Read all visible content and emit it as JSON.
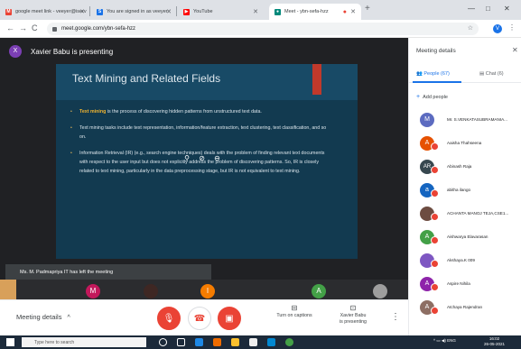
{
  "browser": {
    "tabs": [
      {
        "title": "google meet link - veeyer@iserv",
        "favicon": "gmail-icon",
        "color": "#ea4335",
        "fav_glyph": "M"
      },
      {
        "title": "You are signed in as veeyer.",
        "favicon": "ms-icon",
        "color": "#1a73e8",
        "fav_glyph": "S"
      },
      {
        "title": "YouTube",
        "favicon": "youtube-icon",
        "color": "#ff0000",
        "fav_glyph": "▶"
      },
      {
        "title": "Meet - ybn-sefa-hzz",
        "favicon": "meet-icon",
        "color": "#00897b",
        "fav_glyph": "●"
      }
    ],
    "url": "meet.google.com/ybn-sefa-hzz",
    "profile_initial": "V"
  },
  "meet": {
    "presenter_initial": "X",
    "presenter_text": "Xavier Babu is presenting",
    "slide": {
      "title": "Text Mining and Related Fields",
      "bullet1_highlight": "Text mining",
      "bullet1_rest": " is the process of discovering hidden patterns from unstructured text data.",
      "bullet2": "Text mining tasks include text representation, information/feature extraction, text clustering, text classification, and so on.",
      "bullet3": "Information Retrieval (IR) (e.g., search engine techniques) deals with the problem of finding relevant text documents with respect to the user input but does not explicitly address the problem of discovering patterns. So, IR is closely related to text mining, particularly in the data preprocessing stage, but IR is not equivalent to text mining."
    },
    "toast": "Ms. M. Padmapriya IT has left the meeting",
    "filmstrip": [
      {
        "initial": "M",
        "color": "#c2185b"
      },
      {
        "initial": "",
        "color": "#5d4037"
      },
      {
        "initial": "I",
        "color": "#f57c00"
      },
      {
        "initial": "A",
        "color": "#43a047"
      },
      {
        "initial": "",
        "color": "#9e9e9e"
      }
    ],
    "controls": {
      "meeting_details": "Meeting details",
      "captions": "Turn on captions",
      "presenting_line1": "Xavier Babu",
      "presenting_line2": "is presenting"
    }
  },
  "panel": {
    "title": "Meeting details",
    "people_tab": "People (67)",
    "chat_tab": "Chat (6)",
    "add_people": "Add people",
    "participants": [
      {
        "name": "Mr. S.VENKATASUBRAMANIA...",
        "initial": "M",
        "color": "#5c6bc0"
      },
      {
        "name": "Aaisha Thahseena",
        "initial": "A",
        "color": "#e65100"
      },
      {
        "name": "Abinash Raja",
        "initial": "AR",
        "color": "#37474f"
      },
      {
        "name": "abitha ilango",
        "initial": "a",
        "color": "#1565c0"
      },
      {
        "name": "ACHANTA MANOJ TEJA,CSE1...",
        "initial": "",
        "color": "#6d4c41"
      },
      {
        "name": "Aishwarya Elavarasan",
        "initial": "A",
        "color": "#43a047"
      },
      {
        "name": "Akshaya.K 009",
        "initial": "",
        "color": "#7e57c2"
      },
      {
        "name": "Aspire Nihila",
        "initial": "A",
        "color": "#8e24aa"
      },
      {
        "name": "Atchaya Rajendran",
        "initial": "A",
        "color": "#8d6e63"
      }
    ]
  },
  "taskbar": {
    "search_placeholder": "Type here to search",
    "tray_lang": "ENG",
    "time": "16:02",
    "date": "26-05-2021"
  }
}
